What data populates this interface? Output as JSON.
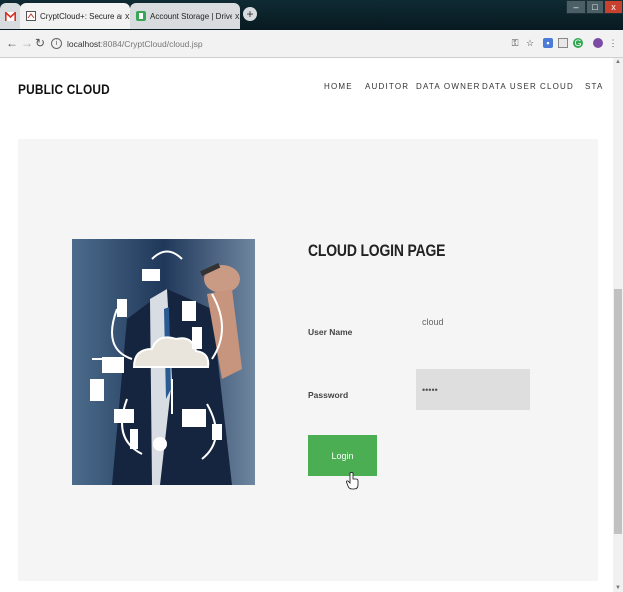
{
  "browser": {
    "tabs": [
      {
        "title": "",
        "icon": "gmail-icon"
      },
      {
        "title": "CryptCloud+: Secure and Expres",
        "icon": "page-icon",
        "active": true
      },
      {
        "title": "Account Storage | DriveHQ",
        "icon": "drivehq-icon",
        "active": false
      }
    ],
    "tab_close_glyph": "x",
    "new_tab_glyph": "+",
    "url_host": "localhost",
    "url_path": ":8084/CryptCloud/cloud.jsp",
    "window_controls": {
      "minimize": "–",
      "maximize": "□",
      "close": "x"
    }
  },
  "site": {
    "brand": "PUBLIC CLOUD",
    "nav": [
      "HOME",
      "AUDITOR",
      "DATA OWNER",
      "DATA USER",
      "CLOUD",
      "STA"
    ]
  },
  "login": {
    "title": "CLOUD LOGIN PAGE",
    "username_label": "User Name",
    "username_value": "cloud",
    "password_label": "Password",
    "password_value": "•••••",
    "button_label": "Login"
  },
  "colors": {
    "accent_green": "#4cae52",
    "panel_bg": "#f5f5f5",
    "password_bg": "#dedede"
  }
}
